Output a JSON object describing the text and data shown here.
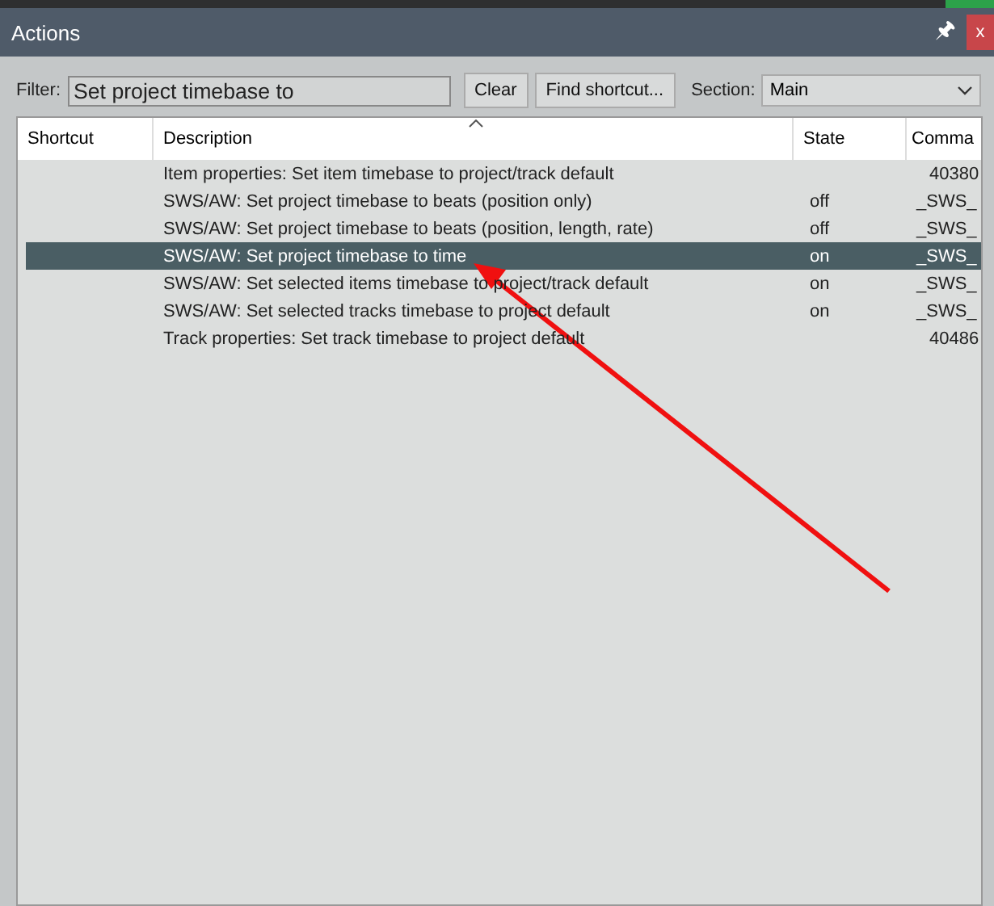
{
  "window": {
    "title": "Actions",
    "pin": "🖈",
    "close": "x"
  },
  "filter": {
    "label": "Filter:",
    "value": "Set project timebase to"
  },
  "buttons": [
    "Clear",
    "Find shortcut..."
  ],
  "section": {
    "label": "Section:",
    "value": "Main"
  },
  "table": {
    "columns": [
      "Shortcut",
      "Description",
      "State",
      "Comma"
    ],
    "rows": [
      {
        "description": "Item properties: Set item timebase to project/track default",
        "state": "",
        "command": "40380",
        "selected": false
      },
      {
        "description": "SWS/AW: Set project timebase to beats (position only)",
        "state": "off",
        "command": "_SWS_",
        "selected": false
      },
      {
        "description": "SWS/AW: Set project timebase to beats (position, length, rate)",
        "state": "off",
        "command": "_SWS_",
        "selected": false
      },
      {
        "description": "SWS/AW: Set project timebase to time",
        "state": "on",
        "command": "_SWS_",
        "selected": true
      },
      {
        "description": "SWS/AW: Set selected items timebase to project/track default",
        "state": "on",
        "command": "_SWS_",
        "selected": false
      },
      {
        "description": "SWS/AW: Set selected tracks timebase to project default",
        "state": "on",
        "command": "_SWS_",
        "selected": false
      },
      {
        "description": "Track properties: Set track timebase to project default",
        "state": "",
        "command": "40486",
        "selected": false
      }
    ]
  }
}
